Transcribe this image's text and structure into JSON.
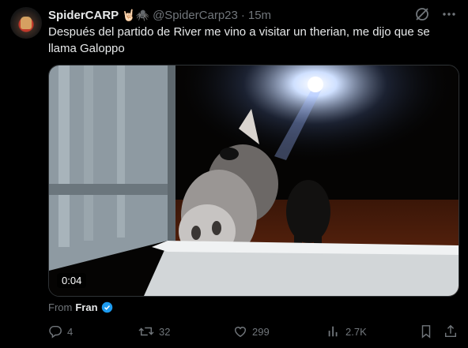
{
  "author": {
    "name": "SpiderCARP",
    "emoji": "🤘🏻🕷️",
    "handle": "@SpiderCarp23",
    "time": "15m"
  },
  "tweet_text": "Después del partido de River me vino a visitar un therian, me dijo que se llama Galoppo",
  "media": {
    "duration": "0:04"
  },
  "attribution": {
    "prefix": "From",
    "source": "Fran"
  },
  "actions": {
    "replies": "4",
    "retweets": "32",
    "likes": "299",
    "views": "2.7K"
  },
  "colors": {
    "background": "#000000",
    "text": "#e7e9ea",
    "muted": "#71767b",
    "verified": "#1d9bf0"
  }
}
